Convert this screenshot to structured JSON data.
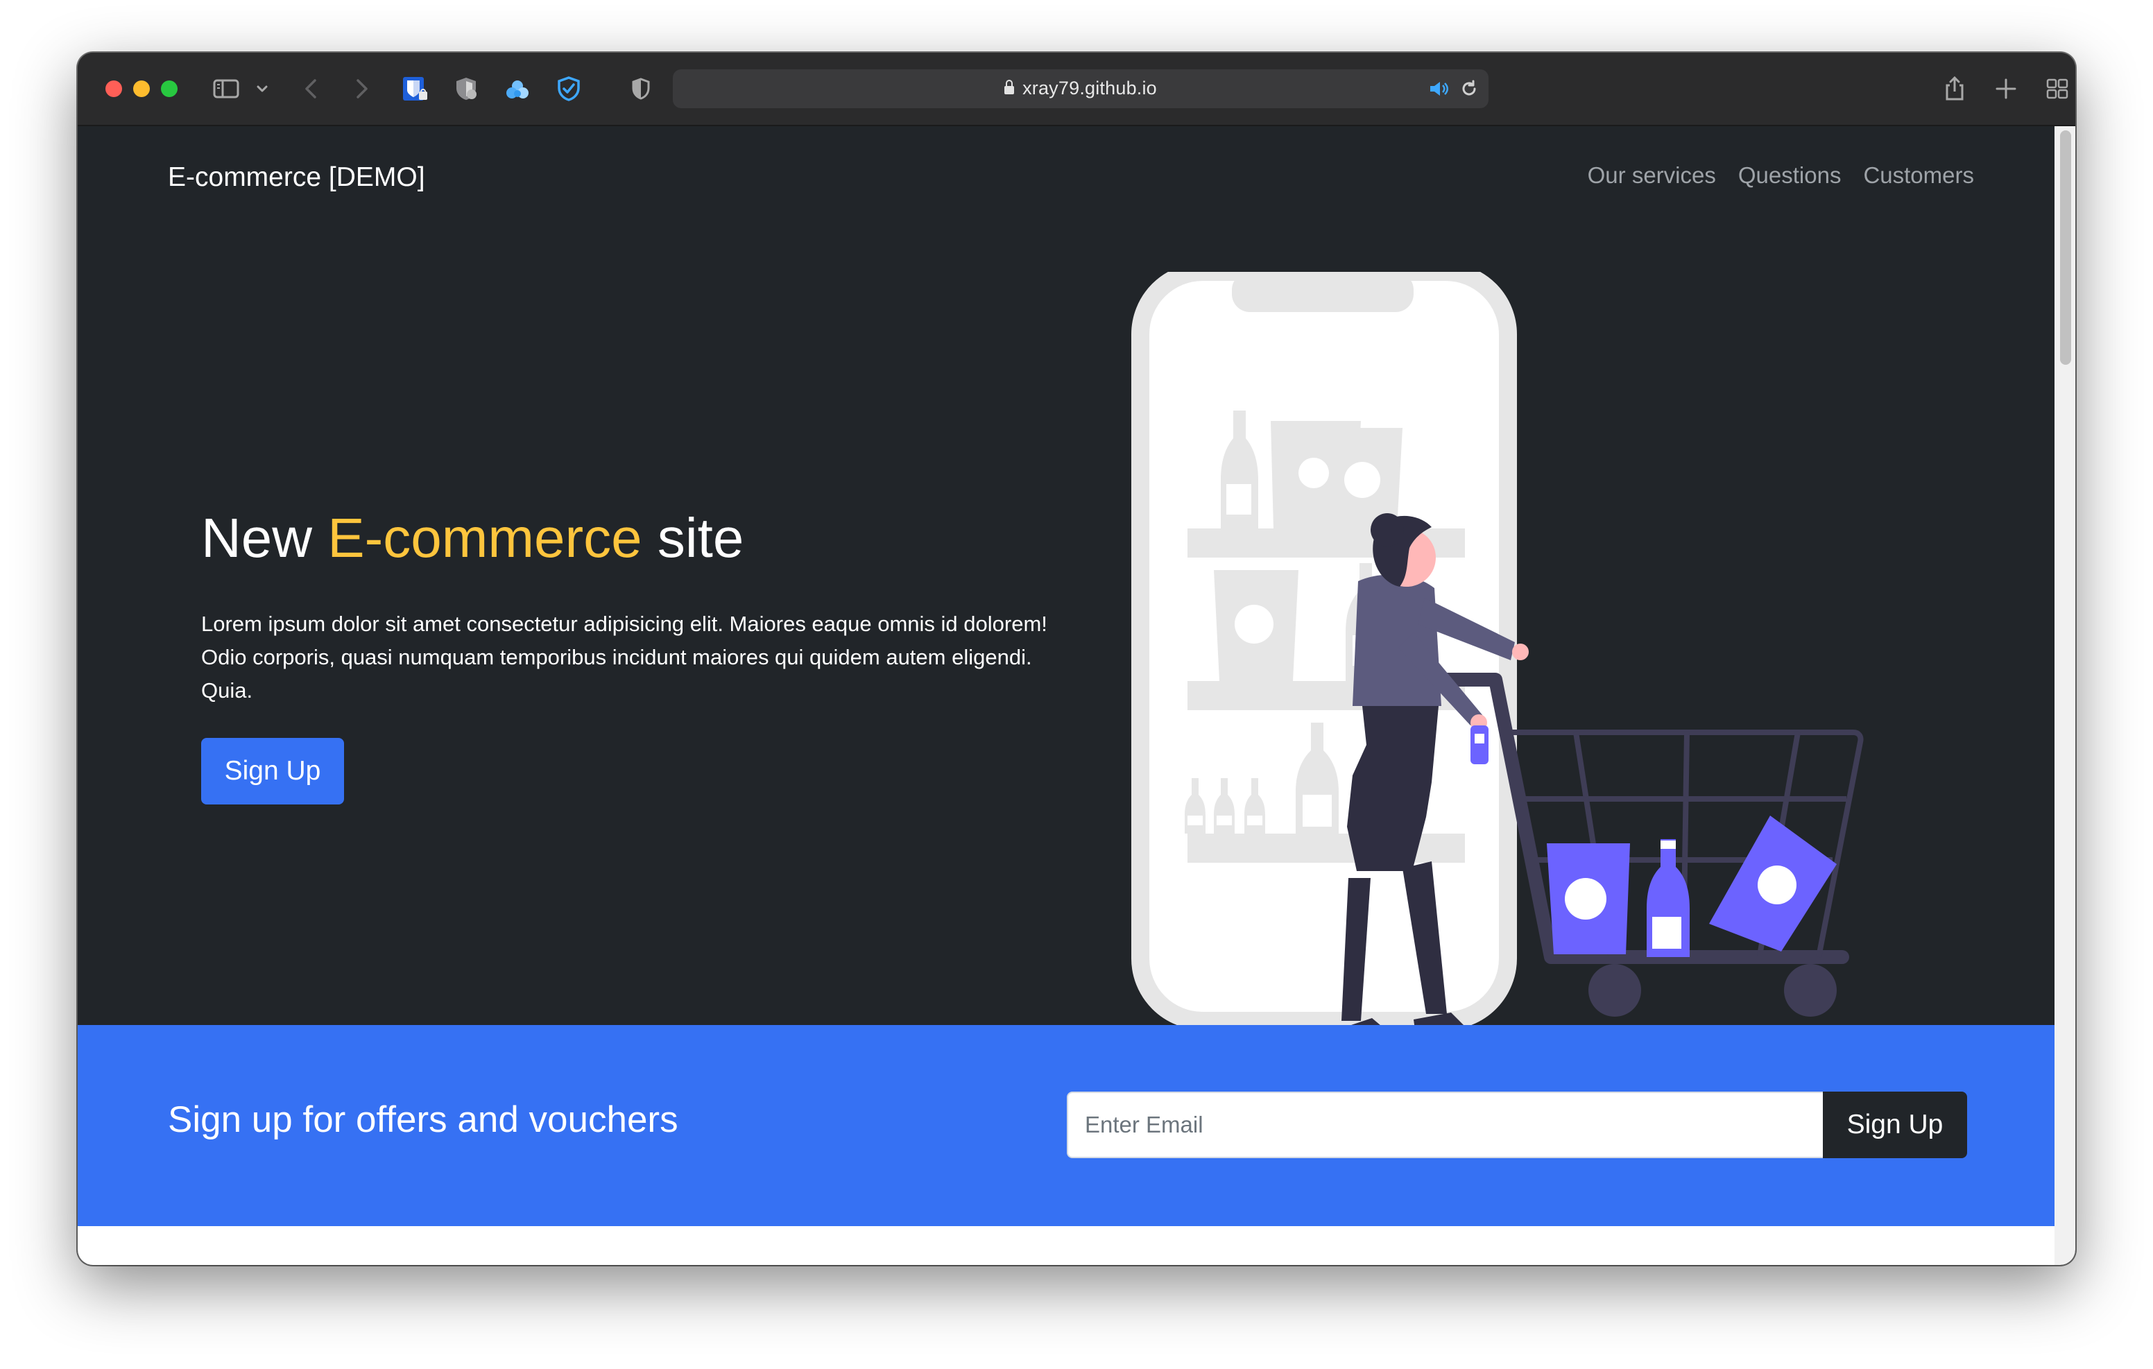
{
  "browser": {
    "url": "xray79.github.io",
    "colors": {
      "close": "#ff5f57",
      "minimize": "#febc2e",
      "zoom": "#28c840"
    },
    "icons": [
      "sidebar-icon",
      "chevron-down-icon",
      "back-icon",
      "forward-icon",
      "bitwarden-icon",
      "privacy-shield-icon",
      "cloud-extension-icon",
      "shield-check-icon",
      "privacy-report-icon",
      "lock-icon",
      "speaker-icon",
      "reload-icon",
      "share-icon",
      "new-tab-icon",
      "tab-overview-icon"
    ]
  },
  "navbar": {
    "brand": "E-commerce [DEMO]",
    "links": [
      "Our services",
      "Questions",
      "Customers"
    ]
  },
  "hero": {
    "title_start": "New ",
    "title_accent": "E-commerce",
    "title_end": " site",
    "text": "Lorem ipsum dolor sit amet consectetur adipisicing elit. Maiores eaque omnis id dolorem! Odio corporis, quasi numquam temporibus incidunt maiores qui quidem autem eligendi. Quia.",
    "button": "Sign Up",
    "accent_color": "#ffc53d"
  },
  "newsletter": {
    "title": "Sign up for offers and vouchers",
    "email_placeholder": "Enter Email",
    "button": "Sign Up",
    "background": "#3671f3"
  }
}
